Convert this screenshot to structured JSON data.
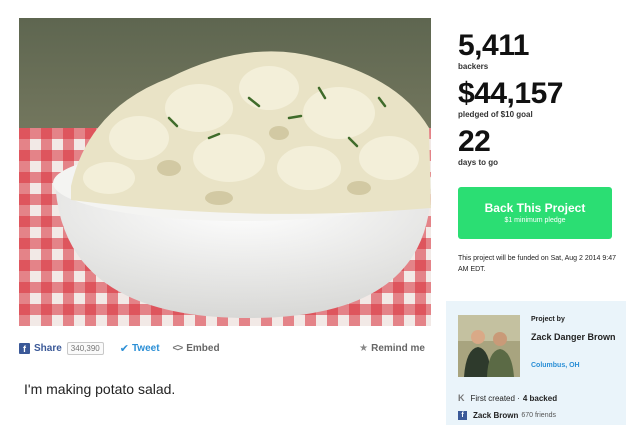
{
  "hero": {
    "image": "potato-salad-photo"
  },
  "share_bar": {
    "share_label": "Share",
    "share_count": "340,390",
    "tweet_label": "Tweet",
    "embed_label": "Embed",
    "remind_label": "Remind me"
  },
  "blurb": "I'm making potato salad.",
  "stats": {
    "backers_value": "5,411",
    "backers_label": "backers",
    "pledged_value": "$44,157",
    "pledged_label": "pledged of $10 goal",
    "days_value": "22",
    "days_label": "days to go"
  },
  "back_button": {
    "label": "Back This Project",
    "sublabel": "$1 minimum pledge"
  },
  "funding_note": "This project will be funded on Sat, Aug 2 2014 9:47 AM EDT.",
  "creator": {
    "label": "Project by",
    "name": "Zack Danger Brown",
    "location": "Columbus, OH",
    "created_text": "First created ·",
    "backed_text": "4 backed",
    "fb_name": "Zack Brown",
    "fb_friends": "670 friends"
  },
  "colors": {
    "accent_green": "#2bde73",
    "facebook_blue": "#3b5998",
    "twitter_blue": "#2b8fd6",
    "creator_bg": "#eaf4fa"
  },
  "icons": [
    "facebook-icon",
    "twitter-bird-icon",
    "code-icon",
    "star-icon",
    "kickstarter-k-icon"
  ]
}
